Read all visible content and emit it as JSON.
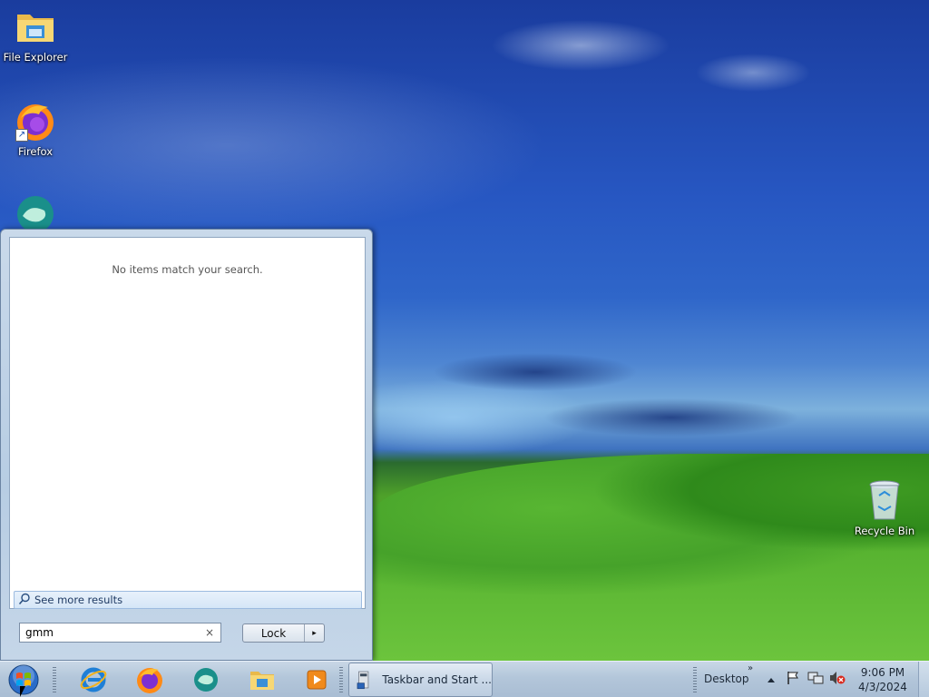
{
  "desktop": {
    "icons": [
      {
        "label": "File Explorer"
      },
      {
        "label": "Firefox"
      },
      {
        "label": "Recycle Bin"
      }
    ]
  },
  "start_menu": {
    "empty_message": "No items match your search.",
    "see_more_label": "See more results",
    "search": {
      "value": "gmm",
      "clear_glyph": "×"
    },
    "power_button": {
      "label": "Lock",
      "arrow_glyph": "▸"
    }
  },
  "taskbar": {
    "pinned": [
      {
        "icon": "internet-explorer-icon"
      },
      {
        "icon": "firefox-icon"
      },
      {
        "icon": "chat-app-icon"
      },
      {
        "icon": "file-explorer-icon"
      },
      {
        "icon": "media-player-icon"
      }
    ],
    "active_task": {
      "label": "Taskbar and Start ..."
    },
    "toolbar_label": "Desktop",
    "toolbar_chevron": "»",
    "clock": {
      "time": "9:06 PM",
      "date": "4/3/2024"
    }
  },
  "colors": {
    "accent": "#1a4fb0",
    "taskbar": "#b3c6da",
    "start_menu": "#c9d9ea"
  }
}
